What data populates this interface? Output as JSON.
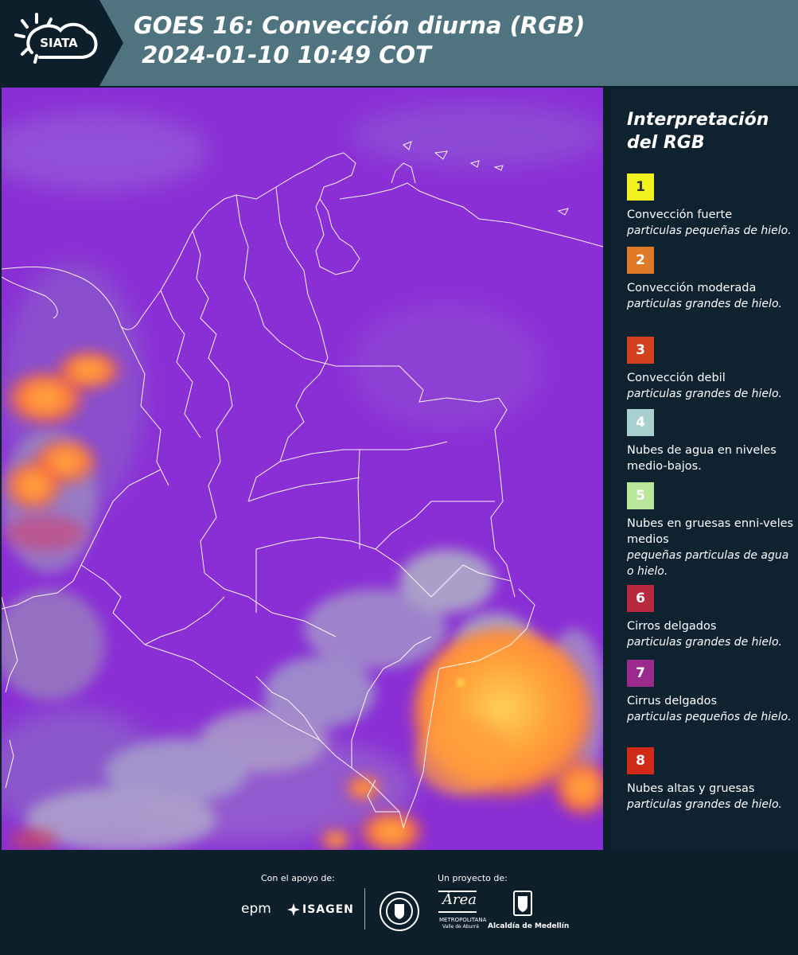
{
  "header": {
    "logo_text": "SIATA",
    "title": "GOES 16: Convección diurna (RGB)\n 2024-01-10 10:49 COT"
  },
  "legend": {
    "title": "Interpretación del RGB",
    "items": [
      {
        "num": "1",
        "color": "#f2f21e",
        "text_color": "#333333",
        "label": "Convección fuerte",
        "sub": "particulas pequeñas de hielo."
      },
      {
        "num": "2",
        "color": "#e17a26",
        "text_color": "#ffffff",
        "label": "Convección moderada",
        "sub": "particulas grandes de hielo."
      },
      {
        "num": "3",
        "color": "#d4411e",
        "text_color": "#ffffff",
        "label": "Convección debil",
        "sub": "particulas grandes de hielo."
      },
      {
        "num": "4",
        "color": "#a8d0cf",
        "text_color": "#ffffff",
        "label": "Nubes de agua en niveles medio-bajos.",
        "sub": ""
      },
      {
        "num": "5",
        "color": "#b8e69a",
        "text_color": "#ffffff",
        "label": "Nubes en gruesas enni-veles medios",
        "sub": "pequeñas particulas de agua o hielo."
      },
      {
        "num": "6",
        "color": "#b8283f",
        "text_color": "#ffffff",
        "label": "Cirros delgados",
        "sub": "particulas grandes de hielo."
      },
      {
        "num": "7",
        "color": "#9a2b8c",
        "text_color": "#ffffff",
        "label": "Cirrus delgados",
        "sub": "particulas pequeños de hielo."
      },
      {
        "num": "8",
        "color": "#d22a18",
        "text_color": "#ffffff",
        "label": "Nubes altas y gruesas",
        "sub": "particulas grandes de hielo."
      }
    ]
  },
  "footer": {
    "support_label": "Con el apoyo de:",
    "project_label": "Un proyecto de:",
    "support_logos": [
      "epm",
      "ISAGEN"
    ],
    "area_logo": "Área",
    "area_sub": "METROPOLITANA",
    "area_sub2": "Valle de Aburrá",
    "alcaldia": "Alcaldía de Medellín"
  }
}
